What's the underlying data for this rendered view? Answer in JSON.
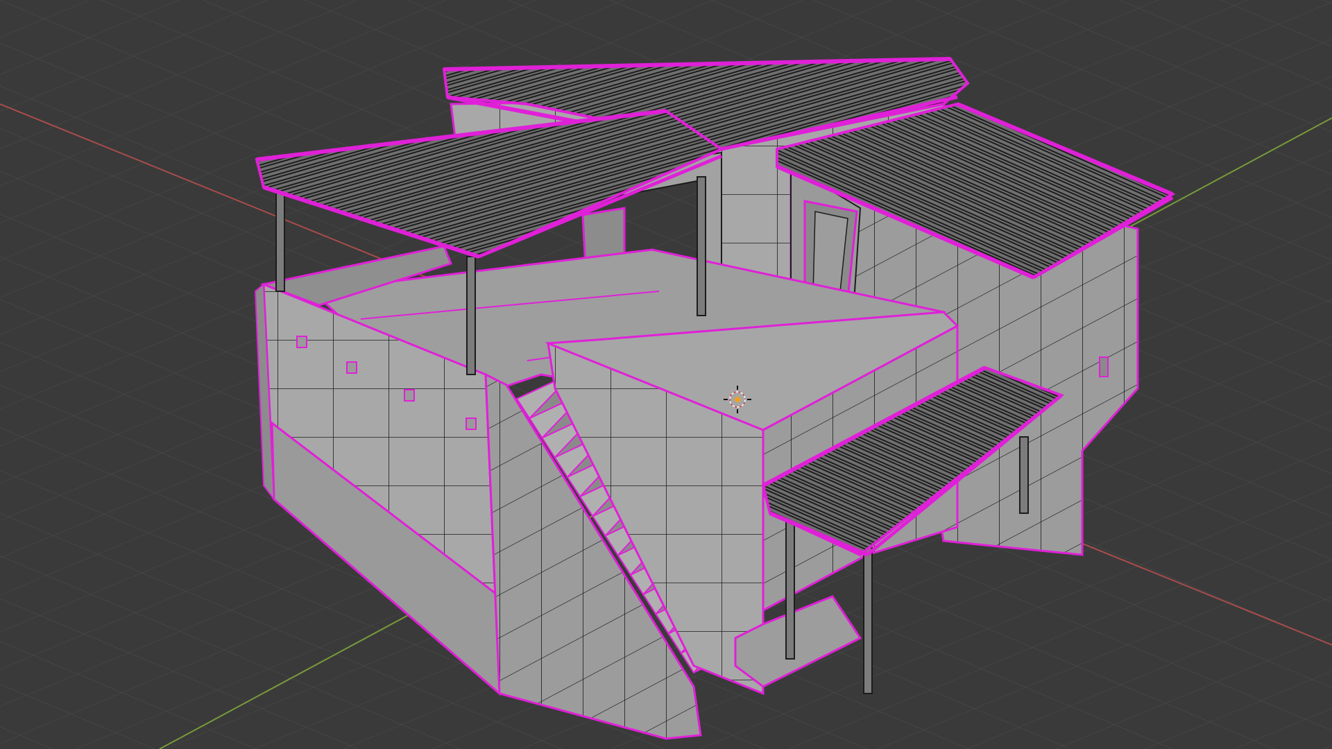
{
  "viewport": {
    "mode": "edit-mode-wireframe-overlay",
    "background_color": "#3a3a3a",
    "grid_color": "#4a4a4a",
    "x_axis_color": "#a94c4c",
    "y_axis_color": "#7a9a3a",
    "selection_color": "#e020d8",
    "mesh_face_color": "#a9a9a9",
    "mesh_shadow_color": "#8e8e8e",
    "edge_color": "#1c1c1c"
  },
  "scene": {
    "object": "adobe-house-model",
    "parts": [
      "upper-roof",
      "left-pergola",
      "right-roof",
      "front-pergola",
      "terrace-walls",
      "staircase",
      "support-posts",
      "doorways",
      "wall-beam-ends"
    ],
    "cursor_icon": "3d-cursor-icon"
  }
}
